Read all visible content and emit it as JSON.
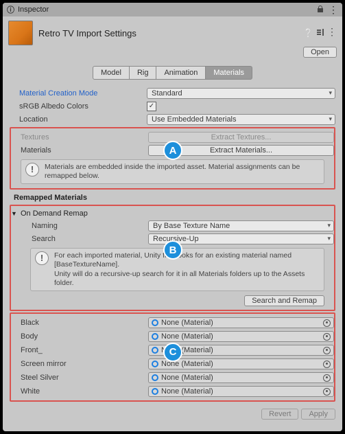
{
  "panel": {
    "title": "Inspector",
    "lock_icon": "lock-icon",
    "menu_icon": "kebab-icon"
  },
  "header": {
    "asset_name": "Retro TV Import Settings",
    "help_icon": "help-icon",
    "preset_icon": "preset-icon",
    "menu_icon": "kebab-icon",
    "open_button": "Open"
  },
  "tabs": [
    "Model",
    "Rig",
    "Animation",
    "Materials"
  ],
  "active_tab": "Materials",
  "fields": {
    "material_creation_mode": {
      "label": "Material Creation Mode",
      "value": "Standard"
    },
    "srgb_albedo": {
      "label": "sRGB Albedo Colors",
      "checked": true
    },
    "location": {
      "label": "Location",
      "value": "Use Embedded Materials"
    },
    "textures": {
      "label": "Textures",
      "button": "Extract Textures..."
    },
    "materials": {
      "label": "Materials",
      "button": "Extract Materials..."
    },
    "info_a": "Materials are embedded inside the imported asset. Material assignments can be remapped below."
  },
  "remap": {
    "section": "Remapped Materials",
    "foldout": "On Demand Remap",
    "naming": {
      "label": "Naming",
      "value": "By Base Texture Name"
    },
    "search": {
      "label": "Search",
      "value": "Recursive-Up"
    },
    "info_b": "For each imported material, Unity first looks for an existing material named [BaseTextureName].\nUnity will do a recursive-up search for it in all Materials folders up to the Assets folder.",
    "search_remap_btn": "Search and Remap"
  },
  "materials_list": [
    {
      "name": "Black",
      "value": "None (Material)"
    },
    {
      "name": "Body",
      "value": "None (Material)"
    },
    {
      "name": "Front_",
      "value": "None (Material)"
    },
    {
      "name": "Screen mirror",
      "value": "None (Material)"
    },
    {
      "name": "Steel Silver",
      "value": "None (Material)"
    },
    {
      "name": "White",
      "value": "None (Material)"
    }
  ],
  "footer": {
    "revert": "Revert",
    "apply": "Apply"
  },
  "badges": {
    "a": "A",
    "b": "B",
    "c": "C"
  },
  "chart_data": null
}
